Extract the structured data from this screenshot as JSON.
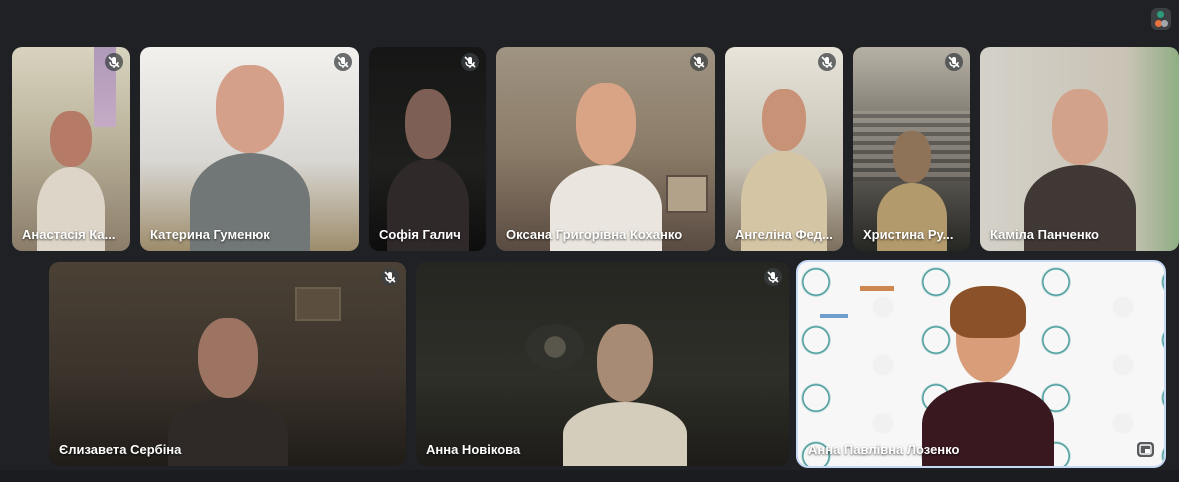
{
  "meeting": {
    "activity_indicator": "active-speaker-icon",
    "tiles": [
      {
        "name": "Анастасія Ка...",
        "muted": true
      },
      {
        "name": "Катерина Гуменюк",
        "muted": true
      },
      {
        "name": "Софія Галич",
        "muted": true
      },
      {
        "name": "Оксана Григорівна Коханко",
        "muted": true
      },
      {
        "name": "Ангеліна Фед...",
        "muted": true
      },
      {
        "name": "Христина Ру...",
        "muted": true
      },
      {
        "name": "Каміла Панченко",
        "muted": true
      },
      {
        "name": "Єлизавета Сербіна",
        "muted": true
      },
      {
        "name": "Анна Новікова",
        "muted": true
      },
      {
        "name": "Анна Павлівна Лозенко",
        "muted": false,
        "speaking": true
      }
    ]
  },
  "colors": {
    "background": "#202124",
    "active_border": "#c6d9f5",
    "label_text": "#ffffff"
  }
}
